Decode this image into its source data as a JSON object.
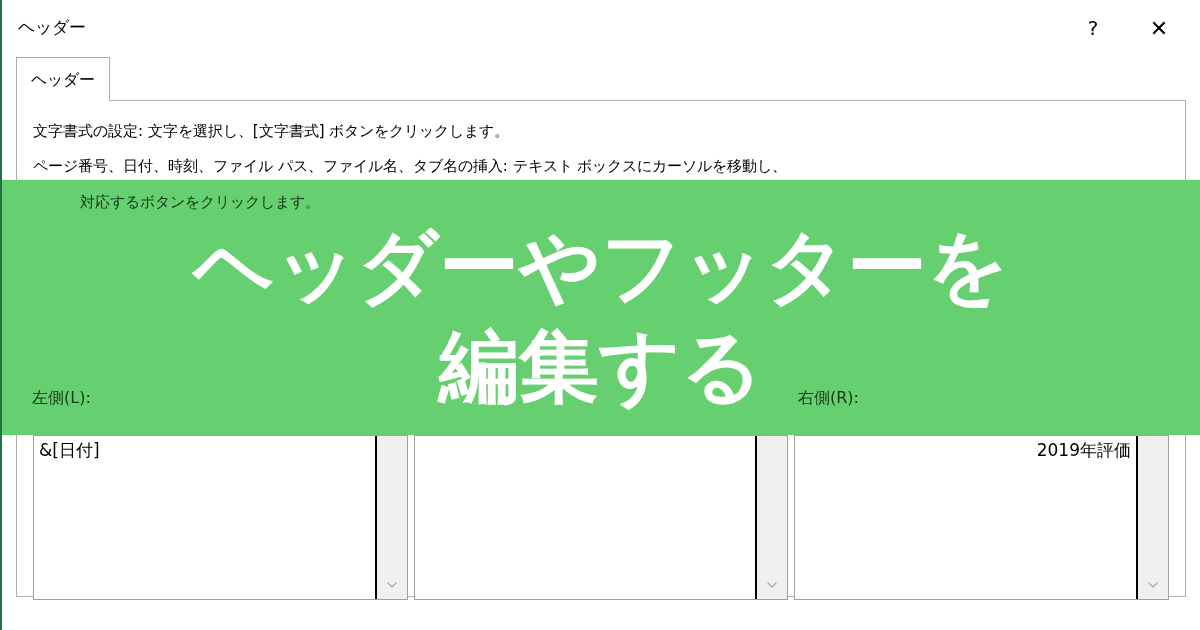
{
  "window": {
    "title": "ヘッダー",
    "help": "?",
    "close": "✕"
  },
  "tabs": [
    {
      "label": "ヘッダー",
      "selected": true
    }
  ],
  "instructions": [
    "文字書式の設定: 文字を選択し、[文字書式] ボタンをクリックします。",
    "ページ番号、日付、時刻、ファイル パス、ファイル名、タブ名の挿入: テキスト ボックスにカーソルを移動し、"
  ],
  "banner": {
    "instruction": "対応するボタンをクリックします。",
    "lines": [
      "ヘッダーやフッターを",
      "編集する"
    ],
    "left_label": "左側(L):",
    "right_label": "右側(R):"
  },
  "fields": {
    "left": "&[日付]",
    "right": "2019年評価"
  }
}
